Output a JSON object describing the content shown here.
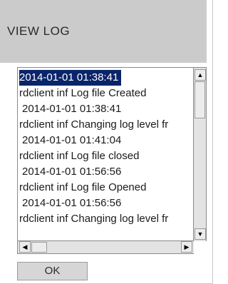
{
  "dialog": {
    "title": "VIEW LOG",
    "ok_label": "OK"
  },
  "log": {
    "lines": [
      "2014-01-01 01:38:41",
      "rdclient inf Log file Created",
      "2014-01-01 01:38:41",
      "rdclient inf Changing log level fr",
      "2014-01-01 01:41:04",
      "rdclient inf Log file closed",
      "2014-01-01 01:56:56",
      "rdclient inf Log file Opened",
      "2014-01-01 01:56:56",
      "rdclient inf Changing log level fr"
    ],
    "selected_index": 0
  },
  "scrollbars": {
    "up_icon": "triangle-up",
    "down_icon": "triangle-down",
    "left_icon": "triangle-left",
    "right_icon": "triangle-right",
    "up_glyph": "▲",
    "down_glyph": "▼",
    "left_glyph": "◀",
    "right_glyph": "▶"
  },
  "colors": {
    "header_bg": "#cbcbcb",
    "selection_bg": "#0a246a",
    "selection_fg": "#ffffff"
  }
}
